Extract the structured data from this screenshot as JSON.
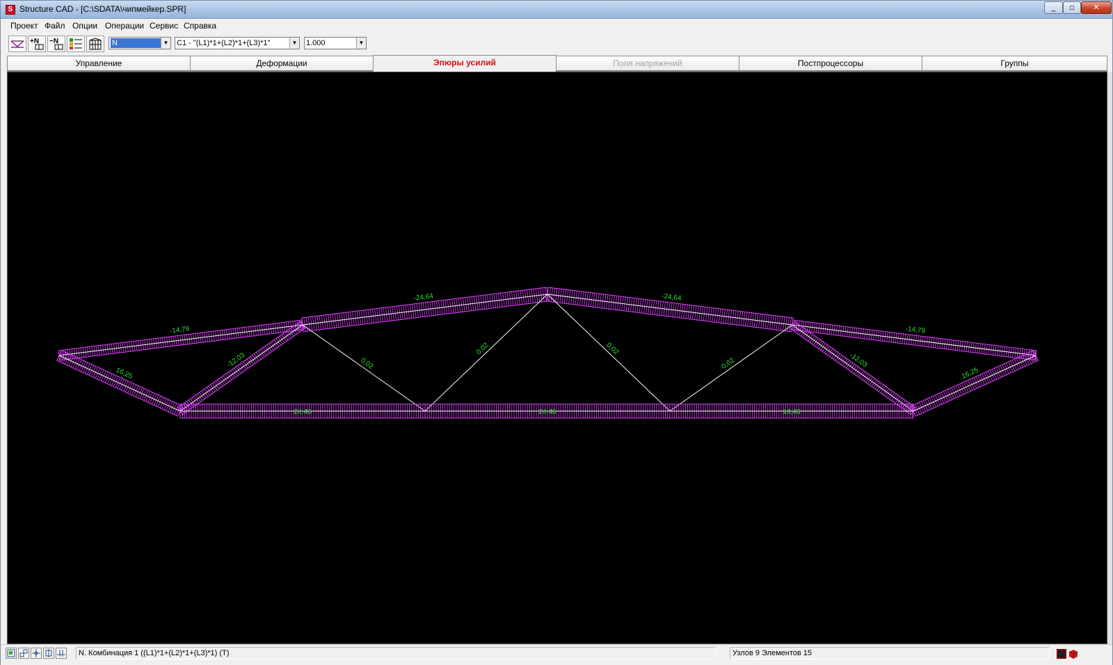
{
  "window": {
    "title": "Structure CAD  - [C:\\SDATA\\чипмейкер.SPR]",
    "app_icon_letter": "S"
  },
  "menu": [
    "Проект",
    "Файл",
    "Опции",
    "Операции",
    "Сервис",
    "Справка"
  ],
  "toolbar": {
    "buttons": [
      "epure-icon",
      "add-node-icon",
      "remove-node-icon",
      "table-icon",
      "grid-icon"
    ],
    "force_select": "N",
    "combination_select": "C1 - \"(L1)*1+(L2)*1+(L3)*1\"",
    "scale_select": "1.000"
  },
  "tabs": [
    {
      "label": "Управление",
      "state": "normal"
    },
    {
      "label": "Деформации",
      "state": "normal"
    },
    {
      "label": "Эпюры усилий",
      "state": "active"
    },
    {
      "label": "Поля напряжений",
      "state": "disabled"
    },
    {
      "label": "Постпроцессоры",
      "state": "normal"
    },
    {
      "label": "Группы",
      "state": "normal"
    }
  ],
  "diagram": {
    "label_color": "#2ee02e",
    "epure_color": "#e040ff",
    "element_color": "#ffffff",
    "values": {
      "top_chord_outer_left": "-14,79",
      "top_chord_inner_left": "-24,64",
      "top_chord_inner_right": "-24,64",
      "top_chord_outer_right": "-14,79",
      "end_diag_left": "16,25",
      "end_diag_right": "16,25",
      "diag_left_1": "-12,03",
      "diag_right_1": "-12,03",
      "web_1": "0,02",
      "web_2": "0,02",
      "web_3": "0,02",
      "web_4": "0,02",
      "bottom_chord_1": "24,46",
      "bottom_chord_2": "24,46",
      "bottom_chord_3": "24,46"
    }
  },
  "status": {
    "buttons": [
      "zoom-window-icon",
      "zoom-fit-icon",
      "pan-icon",
      "select-icon",
      "node-icon"
    ],
    "combination_text": "N. Комбинация 1 ((L1)*1+(L2)*1+(L3)*1) (T)",
    "counts_text": "Узлов 9 Элементов 15"
  }
}
